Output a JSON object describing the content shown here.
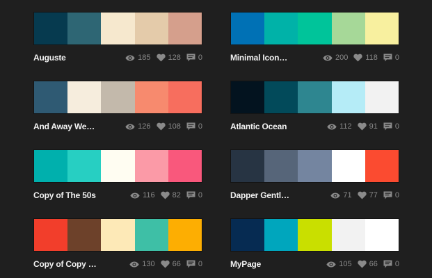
{
  "palettes": [
    {
      "title": "Auguste",
      "colors": [
        "#063a4f",
        "#2e6674",
        "#f6e8ce",
        "#e4cbaa",
        "#d59f8c"
      ],
      "views": "185",
      "likes": "128",
      "comments": "0"
    },
    {
      "title": "Minimal Icon…",
      "colors": [
        "#0071b5",
        "#00b2a8",
        "#00c49a",
        "#a6d898",
        "#f8f09f"
      ],
      "views": "200",
      "likes": "118",
      "comments": "0"
    },
    {
      "title": "And Away We…",
      "colors": [
        "#2f5a73",
        "#f6eddd",
        "#c3b9ab",
        "#f78a6e",
        "#f76e5e"
      ],
      "views": "126",
      "likes": "108",
      "comments": "0"
    },
    {
      "title": "Atlantic Ocean",
      "colors": [
        "#03131f",
        "#024a5a",
        "#2e8690",
        "#b5ecf7",
        "#f2f2f2"
      ],
      "views": "112",
      "likes": "91",
      "comments": "0"
    },
    {
      "title": "Copy of The 50s",
      "colors": [
        "#00b0ad",
        "#27cfc2",
        "#fffdf2",
        "#fb9aa7",
        "#f9587c"
      ],
      "views": "116",
      "likes": "82",
      "comments": "0"
    },
    {
      "title": "Dapper Gentl…",
      "colors": [
        "#273443",
        "#566579",
        "#7485a0",
        "#ffffff",
        "#fb4b30"
      ],
      "views": "71",
      "likes": "77",
      "comments": "0"
    },
    {
      "title": "Copy of Copy …",
      "colors": [
        "#f23e2b",
        "#6d412a",
        "#fde9b7",
        "#3ebfa6",
        "#fdae02"
      ],
      "views": "130",
      "likes": "66",
      "comments": "0"
    },
    {
      "title": "MyPage",
      "colors": [
        "#062b52",
        "#00a6bd",
        "#c9df00",
        "#f2f2f2",
        "#ffffff"
      ],
      "views": "105",
      "likes": "66",
      "comments": "0"
    }
  ],
  "icons": {
    "views": "eye-icon",
    "likes": "heart-icon",
    "comments": "comment-icon"
  },
  "icon_color": "#8a8a8a"
}
